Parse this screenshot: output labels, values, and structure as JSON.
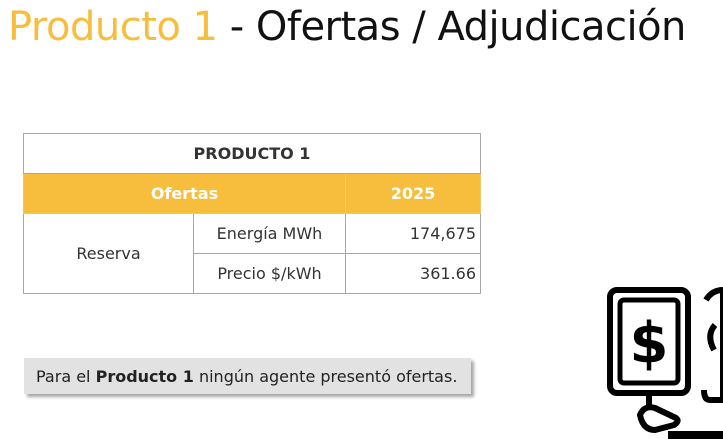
{
  "title": {
    "accent": "Producto 1",
    "rest": " - Ofertas / Adjudicación"
  },
  "colors": {
    "accent": "#F7BE3E",
    "text": "#111111",
    "note_background": "#E2E2E2"
  },
  "table": {
    "product_header": "PRODUCTO 1",
    "header_label": "Ofertas",
    "header_year": "2025",
    "row_group": "Reserva",
    "rows": [
      {
        "metric": "Energía MWh",
        "value": "174,675"
      },
      {
        "metric": "Precio $/kWh",
        "value": "361.66"
      }
    ]
  },
  "note": {
    "prefix": "Para el ",
    "product": "Producto 1",
    "suffix": " ningún agente presentó ofertas."
  },
  "illustration": {
    "icon": "dollar-bill-in-hand-icon"
  }
}
